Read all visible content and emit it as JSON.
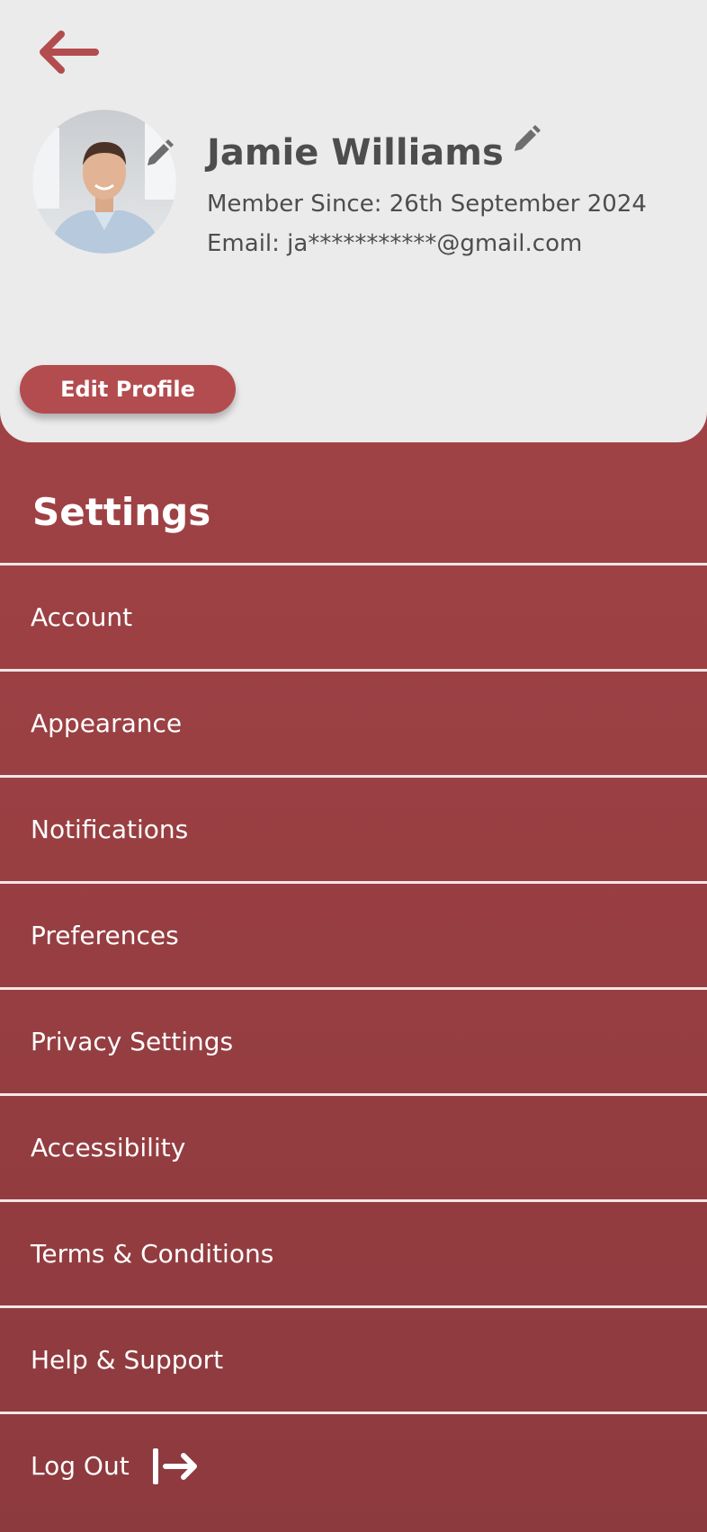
{
  "colors": {
    "accent": "#b34c4f",
    "panel_top": "#a74548",
    "panel_bottom": "#8d3a3e",
    "card": "#ebebeb",
    "text_dark": "#4d4d4d"
  },
  "header": {
    "back_icon": "arrow-left-icon"
  },
  "profile": {
    "name": "Jamie Williams",
    "member_since": "Member Since: 26th September 2024",
    "email": "Email: ja***********@gmail.com",
    "edit_profile_label": "Edit Profile",
    "edit_icon": "pencil-icon"
  },
  "settings": {
    "title": "Settings",
    "items": [
      {
        "label": "Account"
      },
      {
        "label": "Appearance"
      },
      {
        "label": "Notifications"
      },
      {
        "label": "Preferences"
      },
      {
        "label": "Privacy Settings"
      },
      {
        "label": "Accessibility"
      },
      {
        "label": "Terms & Conditions"
      },
      {
        "label": "Help & Support"
      },
      {
        "label": "Log Out",
        "icon": "logout-arrow-icon"
      }
    ]
  }
}
